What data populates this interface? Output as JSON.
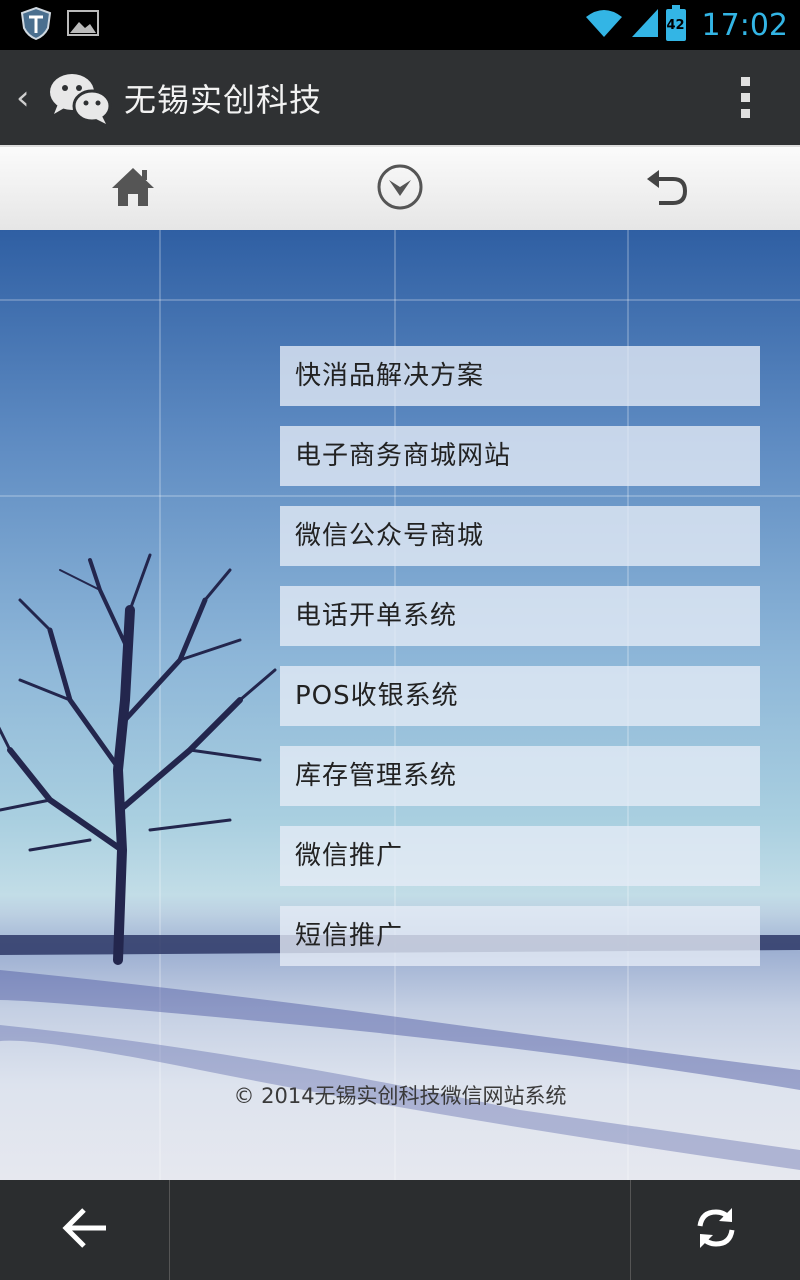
{
  "status_bar": {
    "time": "17:02",
    "battery_level": "42",
    "icons": [
      "shield-icon",
      "image-icon",
      "wifi-icon",
      "signal-icon",
      "battery-icon"
    ]
  },
  "action_bar": {
    "title": "无锡实创科技",
    "icons": [
      "back-chevron-icon",
      "wechat-logo-icon",
      "overflow-menu-icon"
    ]
  },
  "page_nav": {
    "icons": [
      "home-icon",
      "dropdown-circle-icon",
      "undo-icon"
    ]
  },
  "menu": {
    "items": [
      {
        "label": "快消品解决方案"
      },
      {
        "label": "电子商务商城网站"
      },
      {
        "label": "微信公众号商城"
      },
      {
        "label": "电话开单系统"
      },
      {
        "label": "POS收银系统"
      },
      {
        "label": "库存管理系统"
      },
      {
        "label": "微信推广"
      },
      {
        "label": "短信推广"
      }
    ]
  },
  "footer": {
    "copyright": "© 2014无锡实创科技微信网站系统"
  },
  "bottom_bar": {
    "icons": [
      "arrow-left-icon",
      "refresh-icon"
    ]
  },
  "colors": {
    "accent": "#33b5e5",
    "action_bar_bg": "#2f3133",
    "menu_item_bg": "rgba(230,236,246,0.78)"
  }
}
